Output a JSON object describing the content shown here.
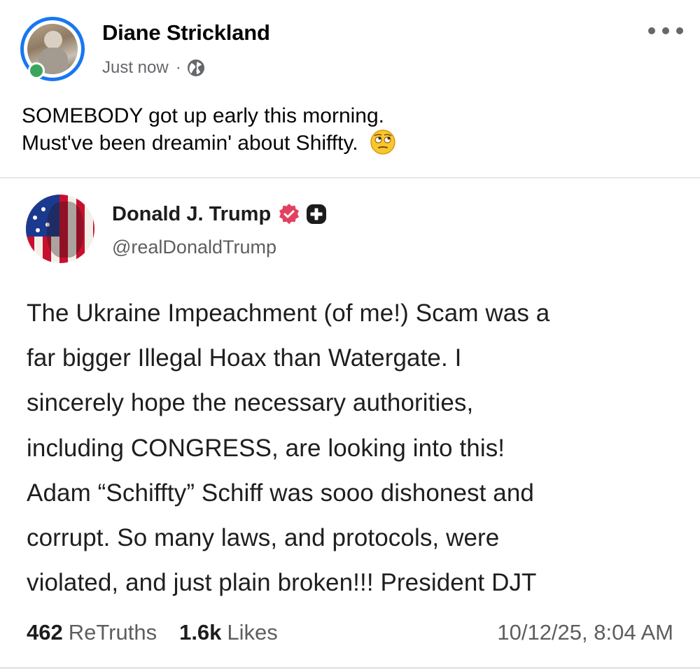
{
  "post": {
    "author_name": "Diane Strickland",
    "timestamp": "Just now",
    "separator": "·",
    "audience_icon": "globe-icon",
    "menu_icon": "more-options-icon",
    "text_lines": [
      "SOMEBODY got up early this morning.",
      "Must've been dreamin' about Shiffty."
    ],
    "emoji": "face-with-rolling-eyes-emoji"
  },
  "shared_truth": {
    "display_name": "Donald J. Trump",
    "verified_icon": "verified-badge-icon",
    "extra_icon": "plus-badge-icon",
    "handle": "@realDonaldTrump",
    "body_lines": [
      "The Ukraine Impeachment (of me!) Scam was a",
      "far bigger Illegal Hoax than Watergate. I",
      "sincerely hope the necessary authorities,",
      "including CONGRESS, are looking into this!",
      "Adam “Schiffty” Schiff was sooo dishonest and",
      "corrupt. So many laws, and protocols, were",
      "violated, and just plain broken!!! President DJT"
    ],
    "stats": {
      "retruths_count": "462",
      "retruths_label": "ReTruths",
      "likes_count": "1.6k",
      "likes_label": "Likes"
    },
    "posted_at": "10/12/25, 8:04 AM"
  },
  "colors": {
    "facebook_blue": "#1877f2",
    "verified_pink": "#e4405f",
    "secondary_text": "#65676b",
    "divider": "#e4e6eb"
  }
}
